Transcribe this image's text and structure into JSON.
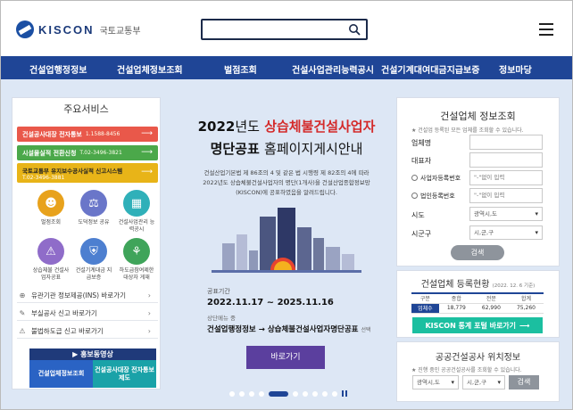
{
  "header": {
    "logo_text": "KISCON",
    "logo_sub": "국토교통부",
    "search_placeholder": ""
  },
  "nav": [
    "건설업행정정보",
    "건설업체정보조회",
    "벌점조회",
    "건설사업관리능력공시",
    "건설기계대여대금지급보증",
    "정보마당"
  ],
  "main_services": {
    "title": "주요서비스",
    "bars": [
      {
        "label": "건설공사대장 전자통보",
        "num": "1.1588-8456",
        "color": "#e9584a"
      },
      {
        "label": "시설물실적 전환신청",
        "num": "T.02-3496-3821",
        "color": "#4ba84a"
      },
      {
        "label": "국토교통부 유지보수공사실적 신고시스템",
        "num": "T.02-3496-3881",
        "color": "#e8b418"
      }
    ],
    "icons": [
      {
        "label": "벌점조회",
        "color": "#e8a21c",
        "glyph": "☻"
      },
      {
        "label": "도덕정보 공유",
        "color": "#6a76c9",
        "glyph": "⚖"
      },
      {
        "label": "건설사업관리 능력공시",
        "color": "#2fb0b9",
        "glyph": "▦"
      },
      {
        "label": "상습체불 건설사업자공표",
        "color": "#8f6cc9",
        "glyph": "⚠"
      },
      {
        "label": "건설기계대금 지급보증",
        "color": "#4d7fd0",
        "glyph": "⛨"
      },
      {
        "label": "하도급참여제한 대상자 게재",
        "color": "#3fa45a",
        "glyph": "⚘"
      }
    ],
    "links": [
      {
        "label": "유관기관 정보제공(INS) 바로가기",
        "icon": "⊕"
      },
      {
        "label": "부실공사 신고 바로가기",
        "icon": "✎"
      },
      {
        "label": "불법하도급 신고 바로가기",
        "icon": "⚠"
      }
    ],
    "promo_title": "홍보동영상",
    "promo_left": "건설업체정보조회",
    "promo_right": "건설공사대장 전자통보제도"
  },
  "banner": {
    "title_year": "2022",
    "title_suffix": "년도",
    "title_red": "상습체불건설사업자",
    "title_line2_a": "명단공표",
    "title_line2_b": "홈페이지게시안내",
    "desc": "건설산업기본법 제 86조의 4 및 같은 법 시행령 제 82조의 4에 따라 2022년도 상습체불건설사업자의 명단(1개사)을 건설산업종합정보망(KISCON)에 공표하였음을 알려드립니다.",
    "period_label": "공표기간",
    "period": "2022.11.17 ~ 2025.11.16",
    "path_label": "상단메뉴 중",
    "path_a": "건설업행정정보",
    "path_arrow": "→",
    "path_b": "상습체불건설사업자명단공표",
    "path_suffix": "선택",
    "button": "바로가기"
  },
  "company_search": {
    "title": "건설업체 정보조회",
    "note": "★ 건설업 등록된 모든 업체를 조회할 수 있습니다.",
    "fields": [
      "업체명",
      "대표자"
    ],
    "radio1": "사업자등록번호",
    "radio2": "법인등록번호",
    "placeholder": "\"-\"없이 입력",
    "sido_label": "시도",
    "sido_value": "광역시,도",
    "sigungu_label": "시군구",
    "sigungu_value": "시,군,구",
    "search_btn": "검색"
  },
  "registration": {
    "title": "건설업체 등록현황",
    "date": "(2022. 12. 6 기준)",
    "headers": [
      "구분",
      "종합",
      "전문",
      "합계"
    ],
    "row_label": "업체수",
    "values": [
      "18,779",
      "62,990",
      "75,260"
    ],
    "portal_btn": "KISCON 통계 포털 바로가기"
  },
  "public_site": {
    "title": "공공건설공사 위치정보",
    "note": "★ 진행 중인 공공건설공사를 조회할 수 있습니다.",
    "sido_value": "광역시,도",
    "sigungu_value": "시,군,구",
    "search_btn": "검색"
  },
  "icon_names": {
    "search": "search-icon",
    "menu": "hamburger-menu-icon"
  }
}
